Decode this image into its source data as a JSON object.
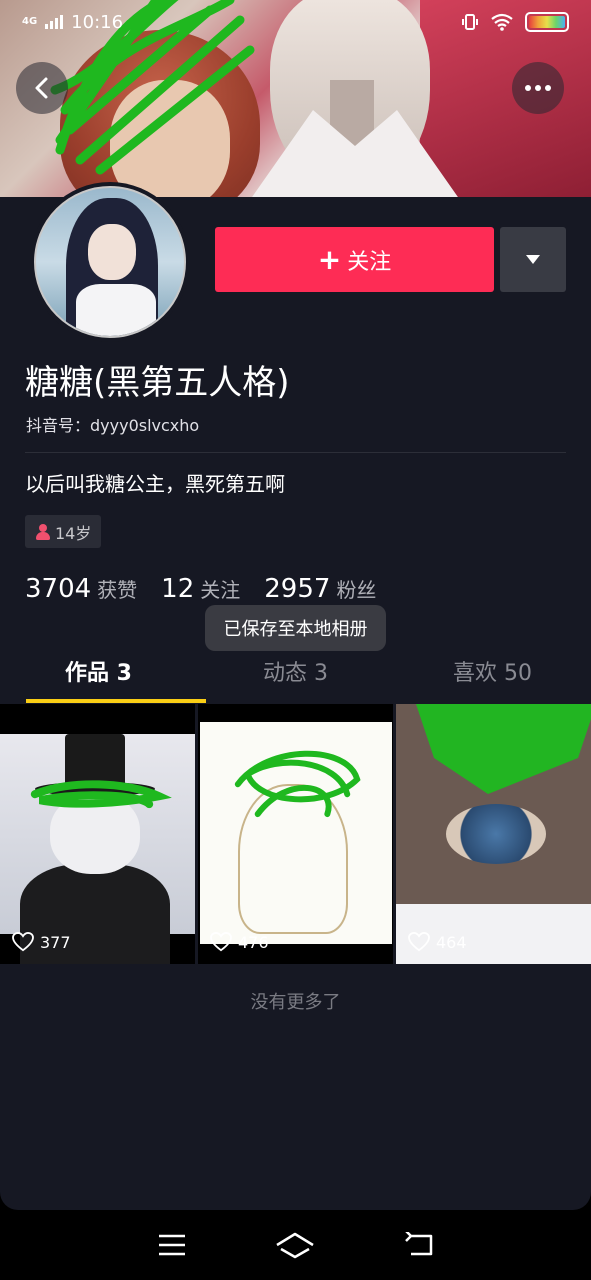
{
  "status_bar": {
    "network": "4G",
    "time": "10:16"
  },
  "profile": {
    "nickname": "糖糖(黑第五人格)",
    "douyin_id": "抖音号：dyyy0slvcxho",
    "bio": "以后叫我糖公主，黑死第五啊",
    "age_tag": "14岁",
    "follow_label": "关注",
    "follow_plus": "+"
  },
  "stats": [
    {
      "num": "3704",
      "label": "获赞"
    },
    {
      "num": "12",
      "label": "关注"
    },
    {
      "num": "2957",
      "label": "粉丝"
    }
  ],
  "toast": "已保存至本地相册",
  "tabs": [
    {
      "label": "作品 3",
      "active": true
    },
    {
      "label": "动态 3",
      "active": false
    },
    {
      "label": "喜欢 50",
      "active": false
    }
  ],
  "videos": [
    {
      "likes": "377"
    },
    {
      "likes": "476"
    },
    {
      "likes": "464"
    }
  ],
  "footer_text": "没有更多了",
  "colors": {
    "background": "#161823",
    "follow_button": "#fe2c55",
    "tab_underline": "#face15",
    "scribble": "#1fb81f"
  },
  "icons": {
    "back": "chevron-left-icon",
    "more": "more-dots-icon",
    "dropdown": "triangle-down-icon",
    "age": "person-icon",
    "heart": "heart-outline-icon",
    "nav_menu": "hamburger-icon",
    "nav_home": "home-icon",
    "nav_back": "return-icon"
  }
}
